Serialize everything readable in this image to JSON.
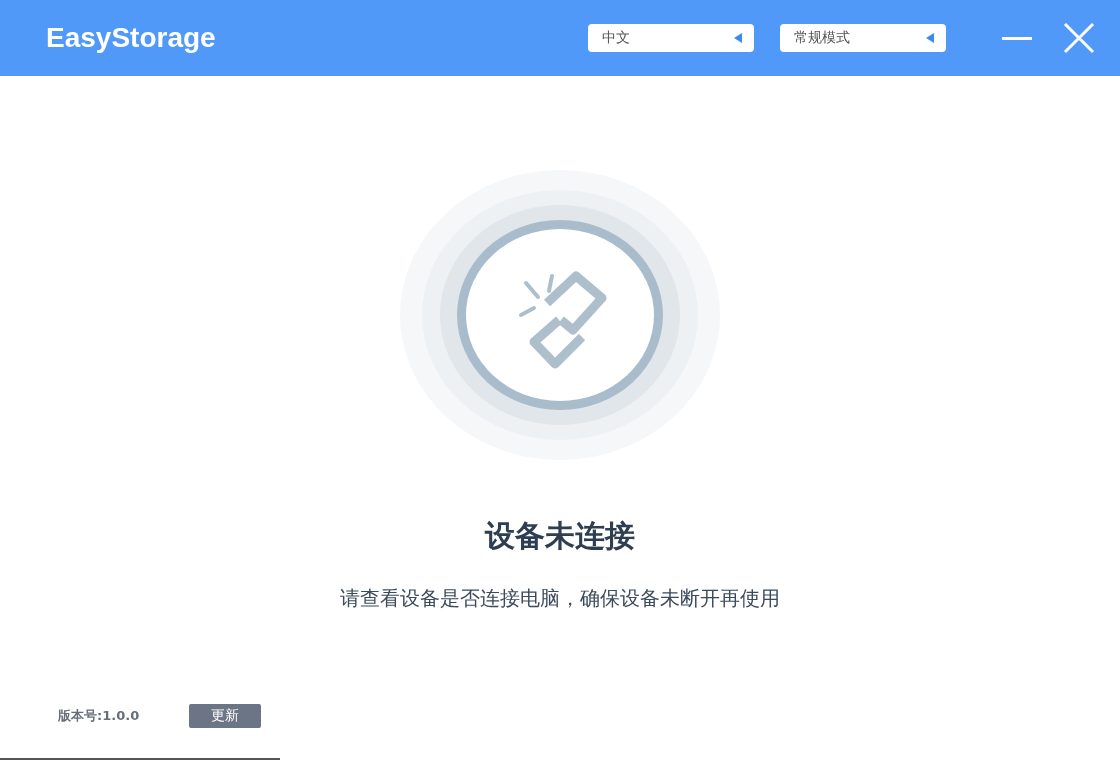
{
  "window": {
    "title": "EasyStorage"
  },
  "selects": [
    {
      "value": "中文"
    },
    {
      "value": "常规模式"
    }
  ],
  "status": {
    "title": "设备未连接",
    "message": "请查看设备是否连接电脑，确保设备未断开再使用"
  },
  "footer": {
    "version": "版本号:1.0.0",
    "update_button": "更新"
  }
}
